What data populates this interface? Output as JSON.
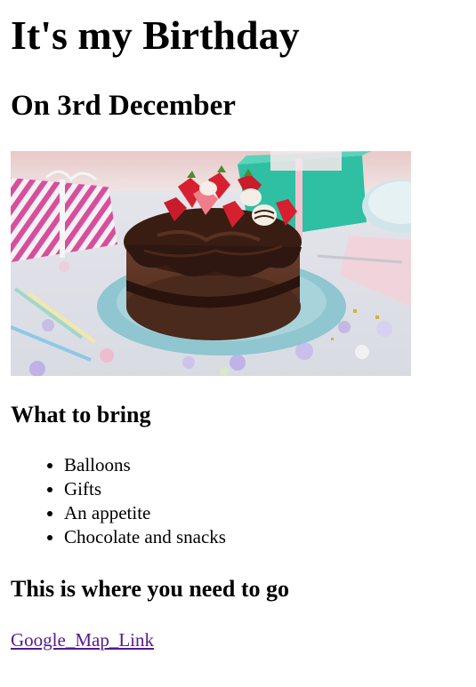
{
  "title": "It's my Birthday",
  "subtitle": "On 3rd December",
  "image": {
    "subject": "chocolate-layer-cake-with-strawberries",
    "colors": {
      "plate": "#8fc6cf",
      "cake": "#5a3324",
      "frosting": "#2e1710",
      "strawberry": "#d6202f",
      "gift_teal": "#2fbfa3",
      "gift_pink": "#d64f9b",
      "table": "#e9e9ee"
    }
  },
  "bring": {
    "heading": "What to bring",
    "items": [
      "Balloons",
      "Gifts",
      "An appetite",
      "Chocolate and snacks"
    ]
  },
  "where": {
    "heading": "This is where you need to go",
    "link_text": "Google_Map_Link"
  }
}
